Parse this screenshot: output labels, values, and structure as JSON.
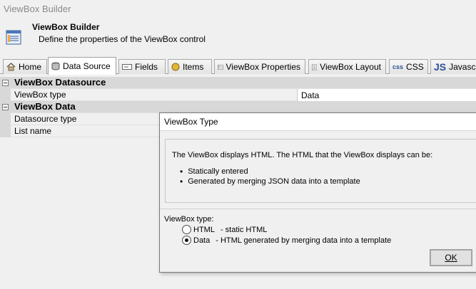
{
  "window": {
    "title": "ViewBox Builder"
  },
  "header": {
    "title": "ViewBox Builder",
    "subtitle": "Define the properties of the ViewBox control",
    "icon": "table-icon"
  },
  "tabs": [
    {
      "label": "Home",
      "icon": "home-icon"
    },
    {
      "label": "Data Source",
      "icon": "database-icon",
      "active": true
    },
    {
      "label": "Fields",
      "icon": "field-icon"
    },
    {
      "label": "Items",
      "icon": "coin-icon"
    },
    {
      "label": "ViewBox Properties",
      "icon": "properties-icon"
    },
    {
      "label": "ViewBox Layout",
      "icon": "layout-icon"
    },
    {
      "label": "CSS",
      "icon": "css-icon",
      "badge": "css"
    },
    {
      "label": "Javascri",
      "icon": "js-icon",
      "badge": "JS"
    }
  ],
  "grid": {
    "sections": [
      {
        "title": "ViewBox Datasource",
        "rows": [
          {
            "label": "ViewBox type",
            "value": "Data"
          }
        ]
      },
      {
        "title": "ViewBox Data",
        "rows": [
          {
            "label": "Datasource type",
            "value": ""
          },
          {
            "label": "List name",
            "value": ""
          }
        ]
      }
    ]
  },
  "dialog": {
    "title": "ViewBox Type",
    "info": "The ViewBox displays HTML. The HTML that the ViewBox displays can be:",
    "bullets": [
      "Statically entered",
      "Generated by merging JSON data into a template"
    ],
    "type_label": "ViewBox type:",
    "options": [
      {
        "label": "HTML",
        "description": "- static HTML",
        "checked": false
      },
      {
        "label": "Data",
        "description": "- HTML generated by merging data into a template",
        "checked": true
      }
    ],
    "ok_label": "OK"
  },
  "colors": {
    "section_bg": "#d8d8d8",
    "window_bg": "#f0f0f0",
    "js_badge": "#2f4f9a"
  }
}
